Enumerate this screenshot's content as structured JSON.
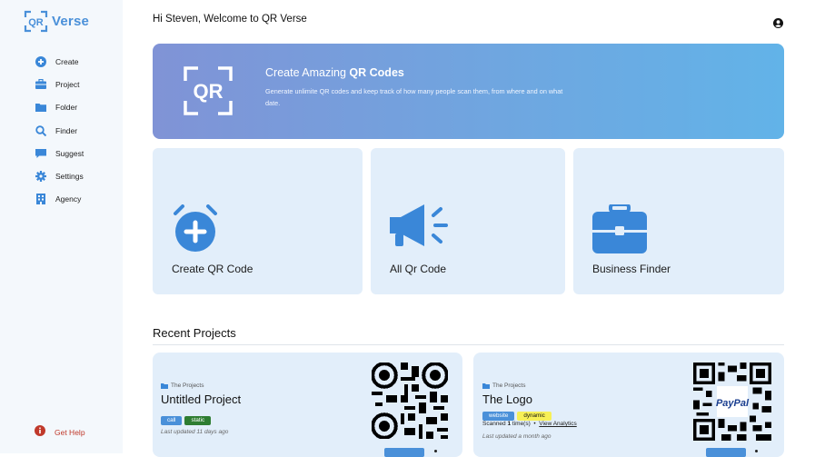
{
  "app": {
    "logo_mark": "QR",
    "logo_text": "Verse",
    "brand_color": "#4a90d9"
  },
  "sidebar": {
    "items": [
      {
        "label": "Create",
        "icon": "plus-circle-icon"
      },
      {
        "label": "Project",
        "icon": "briefcase-icon"
      },
      {
        "label": "Folder",
        "icon": "folder-icon"
      },
      {
        "label": "Finder",
        "icon": "search-icon"
      },
      {
        "label": "Suggest",
        "icon": "comment-icon"
      },
      {
        "label": "Settings",
        "icon": "gear-icon"
      },
      {
        "label": "Agency",
        "icon": "building-icon"
      }
    ],
    "help": {
      "label": "Get Help",
      "icon": "info-icon",
      "color": "#c0392b"
    }
  },
  "header": {
    "greeting": "Hi Steven, Welcome to QR Verse",
    "user_icon": "user-circle-icon"
  },
  "hero": {
    "title_prefix": "Create Amazing ",
    "title_bold": "QR Codes",
    "description": "Generate unlimite QR codes and keep track of how many people scan them, from where and on what date.",
    "icon": "qr-frame-icon"
  },
  "cards": [
    {
      "label": "Create QR Code",
      "icon": "alarm-plus-icon"
    },
    {
      "label": "All Qr Code",
      "icon": "megaphone-icon"
    },
    {
      "label": "Business Finder",
      "icon": "toolbox-icon"
    }
  ],
  "recent": {
    "heading": "Recent Projects",
    "projects": [
      {
        "folder": "The Projects",
        "name": "Untitled Project",
        "tags": [
          {
            "label": "call",
            "color": "#4a90d9"
          },
          {
            "label": "static",
            "color": "#2e7d32"
          }
        ],
        "updated": "Last updated 11 days ago",
        "qr": "qr-code-image"
      },
      {
        "folder": "The Projects",
        "name": "The Logo",
        "tags": [
          {
            "label": "website",
            "color": "#4a90d9"
          },
          {
            "label": "dynamic",
            "color": "#f7f056"
          }
        ],
        "scanned_prefix": "Scanned ",
        "scanned_count": "1",
        "scanned_suffix": " time(s)",
        "separator": "•",
        "analytics_link": "View Analytics",
        "updated": "Last updated a month ago",
        "qr": "paypal-qr-code-image",
        "qr_logo_text": "PayPal"
      }
    ]
  }
}
